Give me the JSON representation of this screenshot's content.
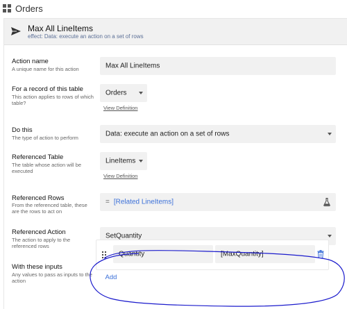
{
  "topbar": {
    "title": "Orders",
    "icon": "grid-icon"
  },
  "action": {
    "name": "Max All LineItems",
    "effect": "effect: Data: execute an action on a set of rows",
    "icon": "send-icon"
  },
  "fields": {
    "action_name": {
      "label": "Action name",
      "desc": "A unique name for this action",
      "value": "Max All LineItems"
    },
    "record_table": {
      "label": "For a record of this table",
      "desc": "This action applies to rows of which table?",
      "value": "Orders",
      "link": "View Definition"
    },
    "do_this": {
      "label": "Do this",
      "desc": "The type of action to perform",
      "value": "Data: execute an action on a set of rows"
    },
    "ref_table": {
      "label": "Referenced Table",
      "desc": "The table whose action will be executed",
      "value": "LineItems",
      "link": "View Definition"
    },
    "ref_rows": {
      "label": "Referenced Rows",
      "desc": "From the referenced table, these are the rows to act on",
      "eq": "=",
      "value": "[Related LineItems]",
      "icon": "flask-icon"
    },
    "ref_action": {
      "label": "Referenced Action",
      "desc": "The action to apply to the referenced rows",
      "value": "SetQuantity"
    },
    "inputs": {
      "label": "With these inputs",
      "desc": "Any values to pass as inputs to the action",
      "rows": [
        {
          "name": "Quantity",
          "value": "[MaxQuantity]"
        }
      ],
      "add_label": "Add"
    }
  },
  "colors": {
    "accent": "#3a6fd8",
    "annotation": "#1a1acc",
    "field_bg": "#f1f1f1"
  }
}
